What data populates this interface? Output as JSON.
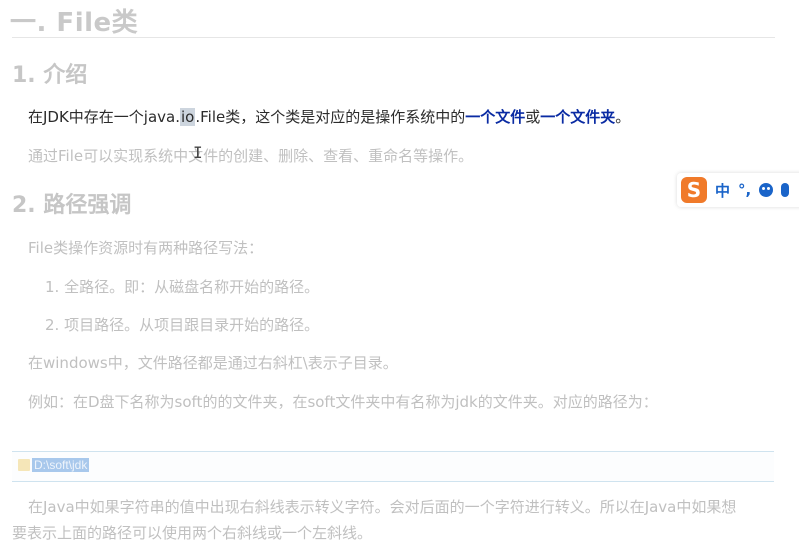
{
  "heading1": "一. File类",
  "section1": {
    "title": "1. 介绍",
    "line1": {
      "prefix": "在JDK中存在一个java.",
      "selected": "io",
      "middle": ".File类，这个类是对应的是操作系统中的",
      "blue1": "一个文件",
      "or": "或",
      "blue2": "一个文件夹",
      "end": "。"
    },
    "line2": "通过File可以实现系统中文件的创建、删除、查看、重命名等操作。"
  },
  "section2": {
    "title": "2. 路径强调",
    "intro": "File类操作资源时有两种路径写法：",
    "items": [
      "1. 全路径。即：从磁盘名称开始的路径。",
      "2. 项目路径。从项目跟目录开始的路径。"
    ],
    "windows_note": "在windows中，文件路径都是通过右斜杠\\表示子目录。",
    "example": "例如：在D盘下名称为soft的的文件夹，在soft文件夹中有名称为jdk的文件夹。对应的路径为：",
    "path_value": "D:\\soft\\jdk",
    "java_note_1": "在Java中如果字符串的值中出现右斜线表示转义字符。会对后面的一个字符进行转义。所以在Java中如果想",
    "java_note_2": "要表示上面的路径可以使用两个右斜线或一个左斜线。"
  },
  "ime": {
    "logo": "S",
    "mode": "中",
    "punct": "°,",
    "icons": [
      "sogou-logo-icon",
      "emoji-icon",
      "microphone-icon"
    ],
    "accent": "#1a64c9",
    "logo_color": "#f07a2a"
  }
}
